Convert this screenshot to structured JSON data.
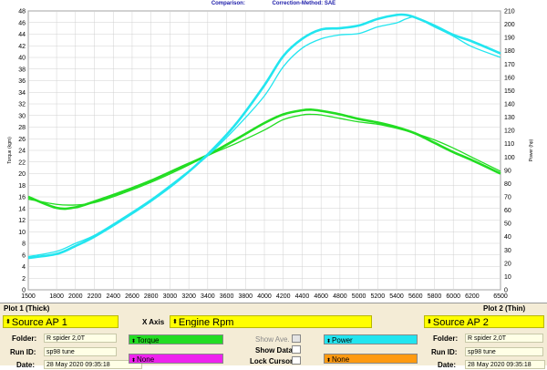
{
  "header": {
    "comparison_label": "Comparison:",
    "correction_label": "Correction-Method: SAE"
  },
  "colors": {
    "torque": "#22dd22",
    "power": "#22e5ef",
    "yellow": "#ffff00",
    "magenta": "#ee22ee",
    "orange": "#ff9a10",
    "panel": "#f4ecd6"
  },
  "chart_data": {
    "type": "line",
    "xlabel": "",
    "ylabel_left": "Torque (kgm)",
    "ylabel_right": "Power (hp)",
    "xlim": [
      1500,
      6500
    ],
    "ylim_left": [
      0,
      48
    ],
    "ylim_right": [
      0,
      210
    ],
    "x_ticks": [
      1500,
      1800,
      2000,
      2200,
      2400,
      2600,
      2800,
      3000,
      3200,
      3400,
      3600,
      3800,
      4000,
      4200,
      4400,
      4600,
      4800,
      5000,
      5200,
      5400,
      5600,
      5800,
      6000,
      6200,
      6500
    ],
    "y_left_ticks": [
      0,
      2,
      4,
      6,
      8,
      10,
      12,
      14,
      16,
      18,
      20,
      22,
      24,
      26,
      28,
      30,
      32,
      34,
      36,
      38,
      40,
      42,
      44,
      46,
      48
    ],
    "y_right_ticks": [
      0,
      10,
      20,
      30,
      40,
      50,
      60,
      70,
      80,
      90,
      100,
      110,
      120,
      130,
      140,
      150,
      160,
      170,
      180,
      190,
      200,
      210
    ],
    "grid": true,
    "series": [
      {
        "name": "Torque",
        "plot": "Source AP 1",
        "axis": "left",
        "thick": true,
        "x": [
          1500,
          1800,
          2000,
          2200,
          2500,
          2800,
          3100,
          3400,
          3700,
          4000,
          4200,
          4400,
          4500,
          4600,
          4800,
          5000,
          5200,
          5400,
          5600,
          5800,
          6000,
          6200,
          6500
        ],
        "y": [
          16.0,
          14.1,
          14.2,
          15.2,
          16.9,
          18.8,
          21.0,
          23.2,
          25.9,
          28.7,
          30.2,
          30.9,
          31.0,
          30.8,
          30.2,
          29.4,
          28.8,
          28.0,
          26.9,
          25.3,
          23.7,
          22.3,
          20.0
        ]
      },
      {
        "name": "Torque",
        "plot": "Source AP 2",
        "axis": "left",
        "thick": false,
        "x": [
          1500,
          1800,
          2000,
          2200,
          2500,
          2800,
          3100,
          3400,
          3700,
          4000,
          4200,
          4400,
          4500,
          4600,
          4800,
          5000,
          5200,
          5400,
          5600,
          5800,
          6000,
          6200,
          6500
        ],
        "y": [
          15.6,
          14.7,
          14.6,
          15.0,
          16.6,
          18.5,
          20.7,
          23.1,
          25.2,
          27.5,
          29.3,
          30.1,
          30.2,
          30.1,
          29.5,
          28.9,
          28.5,
          27.8,
          26.9,
          25.8,
          24.4,
          22.8,
          20.4
        ]
      },
      {
        "name": "Power",
        "plot": "Source AP 1",
        "axis": "right",
        "thick": true,
        "x": [
          1500,
          1800,
          2000,
          2200,
          2500,
          2800,
          3100,
          3400,
          3700,
          4000,
          4200,
          4400,
          4600,
          4800,
          5000,
          5200,
          5400,
          5500,
          5600,
          5800,
          6000,
          6200,
          6500
        ],
        "y": [
          24,
          27,
          33,
          40,
          53,
          67,
          83,
          102,
          125,
          154,
          176,
          189,
          196,
          197,
          199,
          204,
          207,
          207,
          205,
          199,
          192,
          187,
          178
        ]
      },
      {
        "name": "Power",
        "plot": "Source AP 2",
        "axis": "right",
        "thick": false,
        "x": [
          1500,
          1800,
          2000,
          2200,
          2500,
          2800,
          3100,
          3400,
          3700,
          4000,
          4200,
          4400,
          4600,
          4800,
          5000,
          5200,
          5400,
          5500,
          5600,
          5800,
          6000,
          6200,
          6500
        ],
        "y": [
          25,
          29,
          35,
          41,
          54,
          68,
          84,
          101,
          122,
          146,
          168,
          182,
          189,
          192,
          193,
          198,
          201,
          204,
          205,
          198,
          191,
          183,
          175
        ]
      }
    ]
  },
  "panel": {
    "plot1_label": "Plot 1 (Thick)",
    "plot2_label": "Plot 2 (Thin)",
    "source1": "Source AP 1",
    "source2": "Source AP 2",
    "xaxis_label": "X Axis",
    "xaxis_value": "Engine Rpm",
    "folder_label": "Folder:",
    "folder1": "R spider 2,0T",
    "folder2": "R spider 2,0T",
    "runid_label": "Run ID:",
    "runid1": "sp98 tune",
    "runid2": "sp98 tune",
    "date_label": "Date:",
    "date1": "28 May 2020 09:35:18",
    "date2": "28 May 2020 09:35:18",
    "sel_torque": "Torque",
    "sel_power": "Power",
    "sel_none1": "None",
    "sel_none2": "None",
    "show_ave": "Show Ave.",
    "show_data": "Show Data",
    "lock_cursor": "Lock Cursor"
  }
}
